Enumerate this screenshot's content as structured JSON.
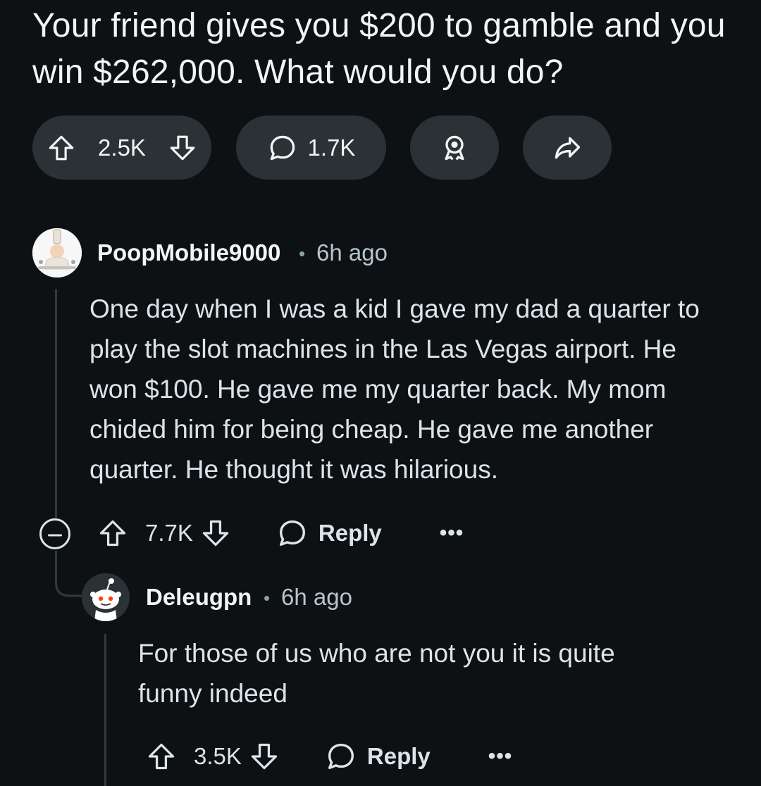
{
  "post": {
    "title": "Your friend gives you $200 to gamble and you win $262,000. What would you do?",
    "vote_count": "2.5K",
    "comment_count": "1.7K"
  },
  "comments": [
    {
      "username": "PoopMobile9000",
      "separator": "•",
      "time": "6h ago",
      "body": "One day when I was a kid I gave my dad a quarter to play the slot machines in the Las Vegas airport. He won $100. He gave me my quarter back. My mom chided him for being cheap. He gave me another quarter. He thought it was hilarious.",
      "vote_count": "7.7K",
      "reply_label": "Reply",
      "more_label": "•••"
    },
    {
      "username": "Deleugpn",
      "separator": "•",
      "time": "6h ago",
      "body": "For those of us who are not you it is quite funny indeed",
      "vote_count": "3.5K",
      "reply_label": "Reply",
      "more_label": "•••"
    }
  ],
  "icons": {
    "upvote": "upvote-icon",
    "downvote": "downvote-icon",
    "comment": "comment-icon",
    "award": "award-icon",
    "share": "share-icon",
    "collapse": "collapse-icon",
    "more": "more-icon"
  },
  "colors": {
    "background": "#0e1113",
    "pill": "#2a3236",
    "text": "#f2f4f5",
    "secondary_text": "#b7c5cc"
  }
}
